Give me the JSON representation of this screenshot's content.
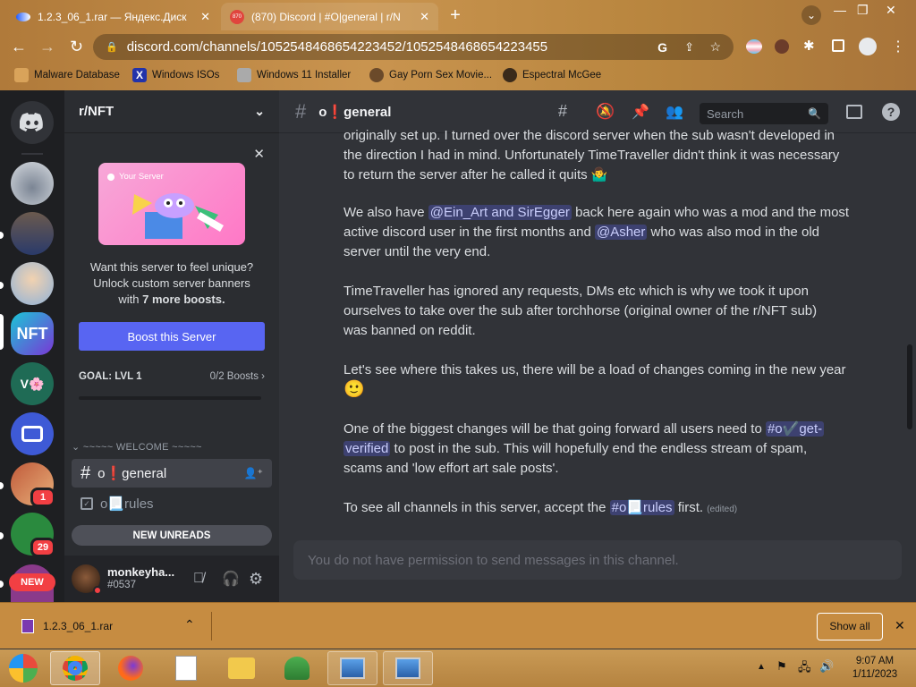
{
  "browser": {
    "tabs": [
      {
        "title": "1.2.3_06_1.rar — Яндекс.Диск"
      },
      {
        "title": "(870) Discord | #O|general | r/N"
      }
    ],
    "tab_badge": "870",
    "url": "discord.com/channels/1052548468654223452/1052548468654223455",
    "bookmarks": [
      "Malware Database",
      "Windows ISOs",
      "Windows 11 Installer",
      "Gay Porn Sex Movie...",
      "Espectral McGee"
    ]
  },
  "server": {
    "name": "r/NFT",
    "promo": {
      "banner_label": "Your Server",
      "text_line1": "Want this server to feel unique?",
      "text_line2": "Unlock custom server banners",
      "text_pre": "with ",
      "text_bold": "7 more boosts.",
      "button": "Boost this Server"
    },
    "goal": {
      "label": "GOAL: LVL 1",
      "boosts": "0/2 Boosts",
      "progress": 0
    },
    "category": "~~~~~ WELCOME ~~~~~",
    "channels": [
      {
        "name": "o❗general",
        "active": true
      },
      {
        "name": "o📃rules",
        "active": false
      }
    ],
    "new_unreads": "NEW UNREADS"
  },
  "guild_badges": {
    "g7": "1",
    "g8": "29",
    "g9": "NEW"
  },
  "user": {
    "name": "monkeyha...",
    "tag": "#0537"
  },
  "channel_header": {
    "name": "o❗general",
    "search_placeholder": "Search"
  },
  "messages": {
    "p1a": "originally set up. I turned over the discord server when the sub wasn't developed in",
    "p1b": "the direction I had in mind. Unfortunately TimeTraveller didn't think it was necessary",
    "p1c": "to return the server after he called it quits 🤷‍♂️",
    "p2_pre": "We also have ",
    "p2_mention1": "@Ein_Art and SirEgger",
    "p2_mid1": " back here again who was a mod and the most",
    "p2_line2_pre": "active discord user in the first months and ",
    "p2_mention2": "@Asher",
    "p2_line2_post": " who was also mod in the old",
    "p2_line3": "server until the very end.",
    "p3a": "TimeTraveller has ignored any requests, DMs etc which is why we took it upon",
    "p3b": "ourselves to take over the sub after torchhorse (original owner of the r/NFT sub)",
    "p3c": "was banned on reddit.",
    "p4a": "Let's see where this takes us, there will be a load of changes coming in the new year",
    "p4b": "🙂",
    "p5_pre": "One of the biggest changes will be that going forward all users need to ",
    "p5_mention_a": "#o✔️get-",
    "p5_mention_b": "verified",
    "p5_post": " to post in the sub. This will hopefully end the endless stream of spam,",
    "p5_line3": "scams and 'low effort art sale posts'.",
    "p6_pre": "To see all channels in this server, accept the ",
    "p6_mention": "#o📃rules",
    "p6_post": " first.",
    "p6_edited": "(edited)"
  },
  "composer_placeholder": "You do not have permission to send messages in this channel.",
  "download": {
    "file": "1.2.3_06_1.rar",
    "show_all": "Show all"
  },
  "taskbar": {
    "time": "9:07 AM",
    "date": "1/11/2023"
  },
  "colors": {
    "blurple": "#5865f2",
    "chrome_bg": "#c28b45",
    "discord_bg": "#313338"
  }
}
